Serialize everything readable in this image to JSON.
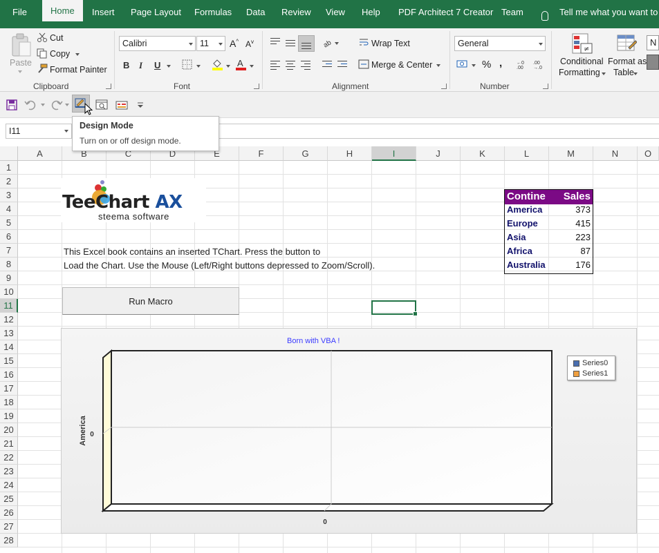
{
  "tabs": [
    "File",
    "Home",
    "Insert",
    "Page Layout",
    "Formulas",
    "Data",
    "Review",
    "View",
    "Help",
    "PDF Architect 7 Creator",
    "Team"
  ],
  "active_tab": "Home",
  "tell_me": "Tell me what you want to do",
  "clipboard": {
    "paste": "Paste",
    "cut": "Cut",
    "copy": "Copy",
    "format_painter": "Format Painter",
    "label": "Clipboard"
  },
  "font": {
    "name": "Calibri",
    "size": "11",
    "bold": "B",
    "italic": "I",
    "underline": "U",
    "label": "Font"
  },
  "alignment": {
    "wrap_text": "Wrap Text",
    "merge_center": "Merge & Center",
    "label": "Alignment"
  },
  "number": {
    "format": "General",
    "percent": "%",
    "comma": ",",
    "label": "Number"
  },
  "styles": {
    "conditional_formatting_1": "Conditional",
    "conditional_formatting_2": "Formatting",
    "format_as_table_1": "Format as",
    "format_as_table_2": "Table",
    "cell_styles_cut": "N"
  },
  "name_box": "I11",
  "tooltip": {
    "title": "Design Mode",
    "description": "Turn on or off design mode."
  },
  "columns": [
    "A",
    "B",
    "C",
    "D",
    "E",
    "F",
    "G",
    "H",
    "I",
    "J",
    "K",
    "L",
    "M",
    "N",
    "O"
  ],
  "rows": [
    "1",
    "2",
    "3",
    "4",
    "5",
    "6",
    "7",
    "8",
    "9",
    "10",
    "11",
    "12",
    "13",
    "14",
    "15",
    "16",
    "17",
    "18",
    "19",
    "20",
    "21",
    "22",
    "23",
    "24",
    "25",
    "26",
    "27",
    "28"
  ],
  "selected_column": "I",
  "selected_row": "11",
  "logo": {
    "brand_a": "TeeChart",
    "brand_b": "AX",
    "sub": "steema software"
  },
  "description_lines": [
    "This Excel book contains an inserted TChart. Press the button to",
    "Load the Chart. Use the Mouse (Left/Right buttons depressed to Zoom/Scroll)."
  ],
  "run_macro_button": "Run Macro",
  "data_table": {
    "headers": [
      "Contine",
      "Sales"
    ],
    "rows": [
      {
        "name": "America",
        "value": "373"
      },
      {
        "name": "Europe",
        "value": "415"
      },
      {
        "name": "Asia",
        "value": "223"
      },
      {
        "name": "Africa",
        "value": "87"
      },
      {
        "name": "Australia",
        "value": "176"
      }
    ],
    "header_color": "#7b0a85"
  },
  "chart_data": {
    "type": "bar",
    "title": "Born with VBA !",
    "ylabel": "America",
    "xlabel": "",
    "x_ticks": [
      "0"
    ],
    "y_ticks": [
      "0"
    ],
    "series": [
      {
        "name": "Series0",
        "values": [],
        "color": "#4a6fb0"
      },
      {
        "name": "Series1",
        "values": [],
        "color": "#f0a040"
      }
    ],
    "legend_position": "top-right",
    "grid": true
  },
  "colors": {
    "excel_green": "#217346",
    "title_blue": "#3a3aff"
  }
}
